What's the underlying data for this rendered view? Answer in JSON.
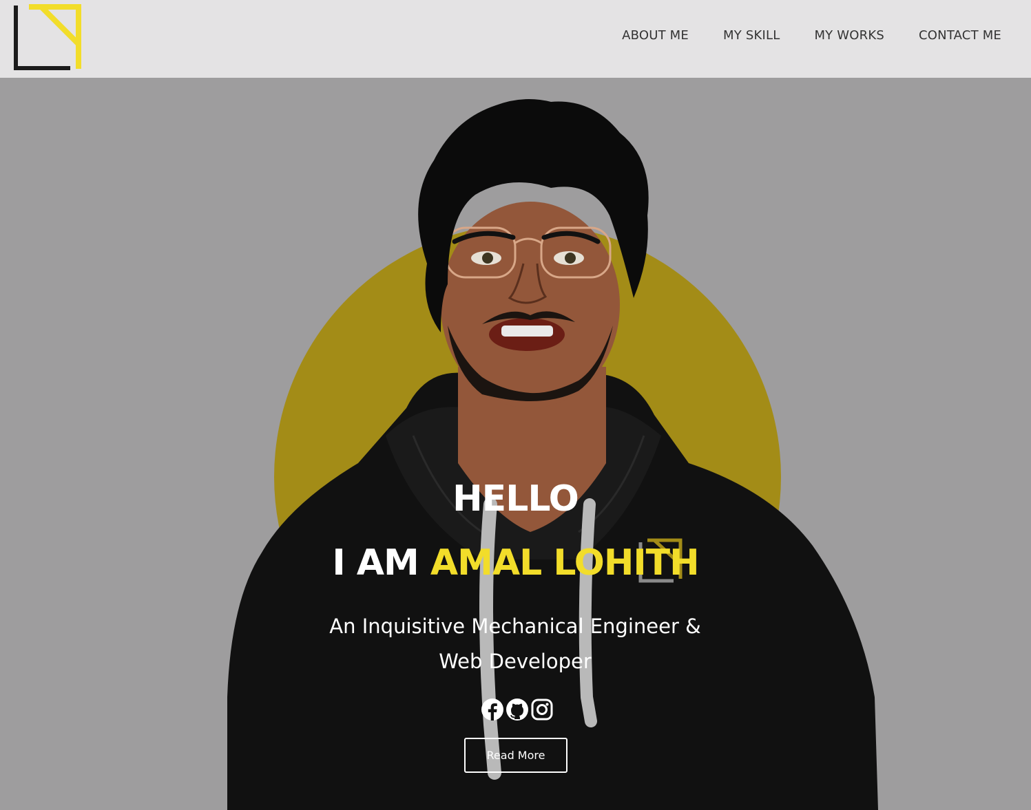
{
  "nav": {
    "logo_alt": "LN logo",
    "links": [
      {
        "label": "ABOUT ME"
      },
      {
        "label": "MY SKILL"
      },
      {
        "label": "MY WORKS"
      },
      {
        "label": "CONTACT ME"
      }
    ]
  },
  "hero": {
    "greeting": "HELLO",
    "intro_prefix": "I AM ",
    "name": "AMAL LOHITH",
    "subtitle_line1": "An Inquisitive Mechanical Engineer &",
    "subtitle_line2": "Web Developer",
    "socials": [
      {
        "icon": "facebook-icon"
      },
      {
        "icon": "github-icon"
      },
      {
        "icon": "instagram-icon"
      }
    ],
    "cta_label": "Read More"
  },
  "colors": {
    "accent": "#f2dd2a",
    "nav_background": "#e4e3e4",
    "hero_background": "#9e9d9e",
    "circle": "#a38c17",
    "hoodie": "#111111"
  }
}
